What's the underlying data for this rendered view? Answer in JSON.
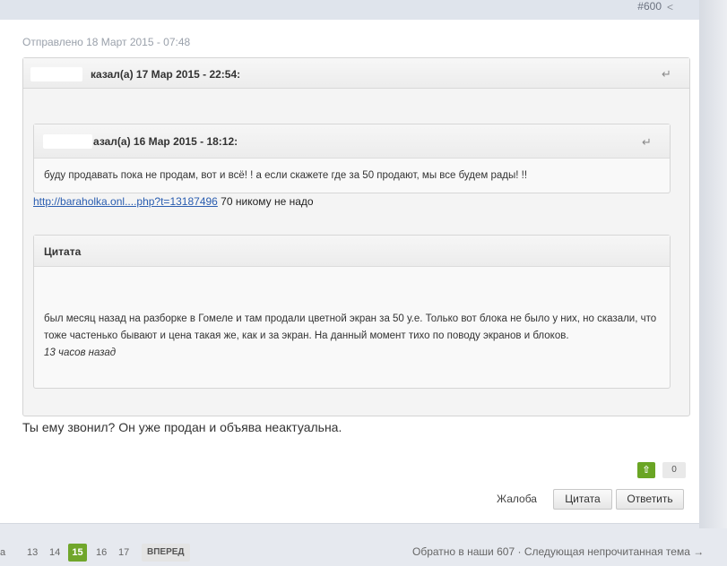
{
  "post": {
    "number": "#600",
    "sent_date": "Отправлено 18 Март 2015 - 07:48",
    "outer_quote": {
      "title": "казал(а) 17 Мар 2015 - 22:54:"
    },
    "inner_quote": {
      "title": "азал(а) 16 Мар 2015 - 18:12:",
      "body": "буду продавать пока не продам, вот и всё! ! а если скажете где за 50 продают, мы все будем рады! !!"
    },
    "link_text": "http://baraholka.onl....php?t=13187496",
    "link_suffix": " 70 никому не надо",
    "citation": {
      "title": "Цитата",
      "body": "был месяц назад на разборке в Гомеле и там продали цветной экран за 50 у.е. Только вот блока не было у них, но сказали, что тоже частенько бывают и цена такая же, как и за экран. На данный момент тихо по поводу экранов и блоков.",
      "time": "13 часов назад"
    },
    "reply_text": "Ты ему звонил? Он уже продан и объява неактуальна.",
    "vote_count": "0",
    "actions": {
      "report": "Жалоба",
      "quote": "Цитата",
      "reply": "Ответить"
    }
  },
  "pager": {
    "pages": [
      "17",
      "13",
      "14",
      "15",
      "16",
      "17"
    ],
    "first_prefix": "a",
    "active": "15",
    "next": "ВПЕРЕД"
  },
  "footer": {
    "back": "Обратно в наши 607",
    "separator": "·",
    "next_unread": "Следующая непрочитанная тема →"
  },
  "icons": {
    "share": "share-icon",
    "reply": "reply-arrow-icon",
    "vote_up": "arrow-up-icon"
  },
  "colors": {
    "accent_green": "#6aa524",
    "link_blue": "#2a5db0"
  }
}
